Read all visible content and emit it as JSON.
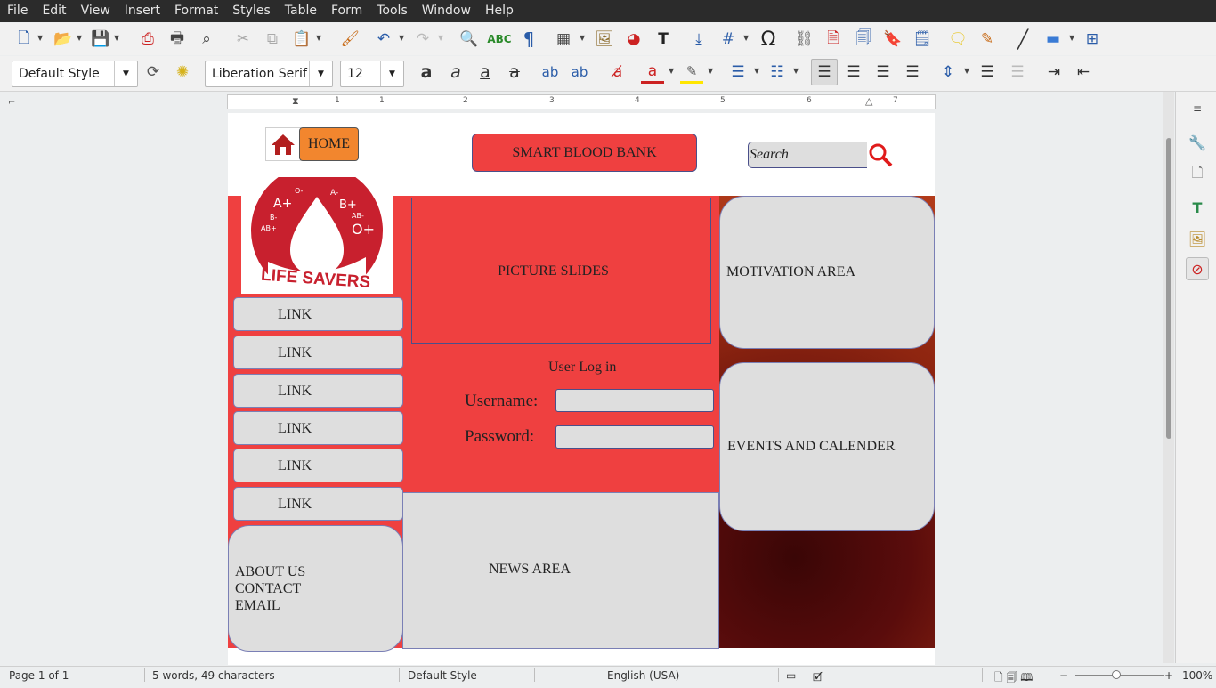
{
  "menu": [
    "File",
    "Edit",
    "View",
    "Insert",
    "Format",
    "Styles",
    "Table",
    "Form",
    "Tools",
    "Window",
    "Help"
  ],
  "toolbar": {
    "paragraph_style": "Default Style",
    "font_name": "Liberation Serif",
    "font_size": "12"
  },
  "ruler": {
    "numbers": [
      "1",
      "1",
      "2",
      "3",
      "4",
      "5",
      "6",
      "7"
    ]
  },
  "doc": {
    "home_label": "HOME",
    "title": "SMART BLOOD BANK",
    "search_placeholder": "Search",
    "logo": {
      "groups": [
        "A+",
        "A-",
        "B+",
        "B-",
        "AB+",
        "AB-",
        "O+",
        "O-"
      ],
      "text": "LIFE SAVERS"
    },
    "links": [
      "LINK",
      "LINK",
      "LINK",
      "LINK",
      "LINK",
      "LINK"
    ],
    "about": [
      "ABOUT US",
      "CONTACT",
      "EMAIL"
    ],
    "picture_slides": "PICTURE SLIDES",
    "login": {
      "title": "User Log in",
      "username_label": "Username:",
      "password_label": "Password:"
    },
    "news": "NEWS AREA",
    "motivation": "MOTIVATION AREA",
    "events": "EVENTS AND CALENDER"
  },
  "status": {
    "page": "Page 1 of 1",
    "words": "5 words, 49 characters",
    "style": "Default Style",
    "language": "English (USA)",
    "zoom": "100%"
  },
  "colors": {
    "banner_red": "#ef4040",
    "home_orange": "#f2862e",
    "box_gray": "#dedede",
    "logo_red": "#c8202e"
  }
}
